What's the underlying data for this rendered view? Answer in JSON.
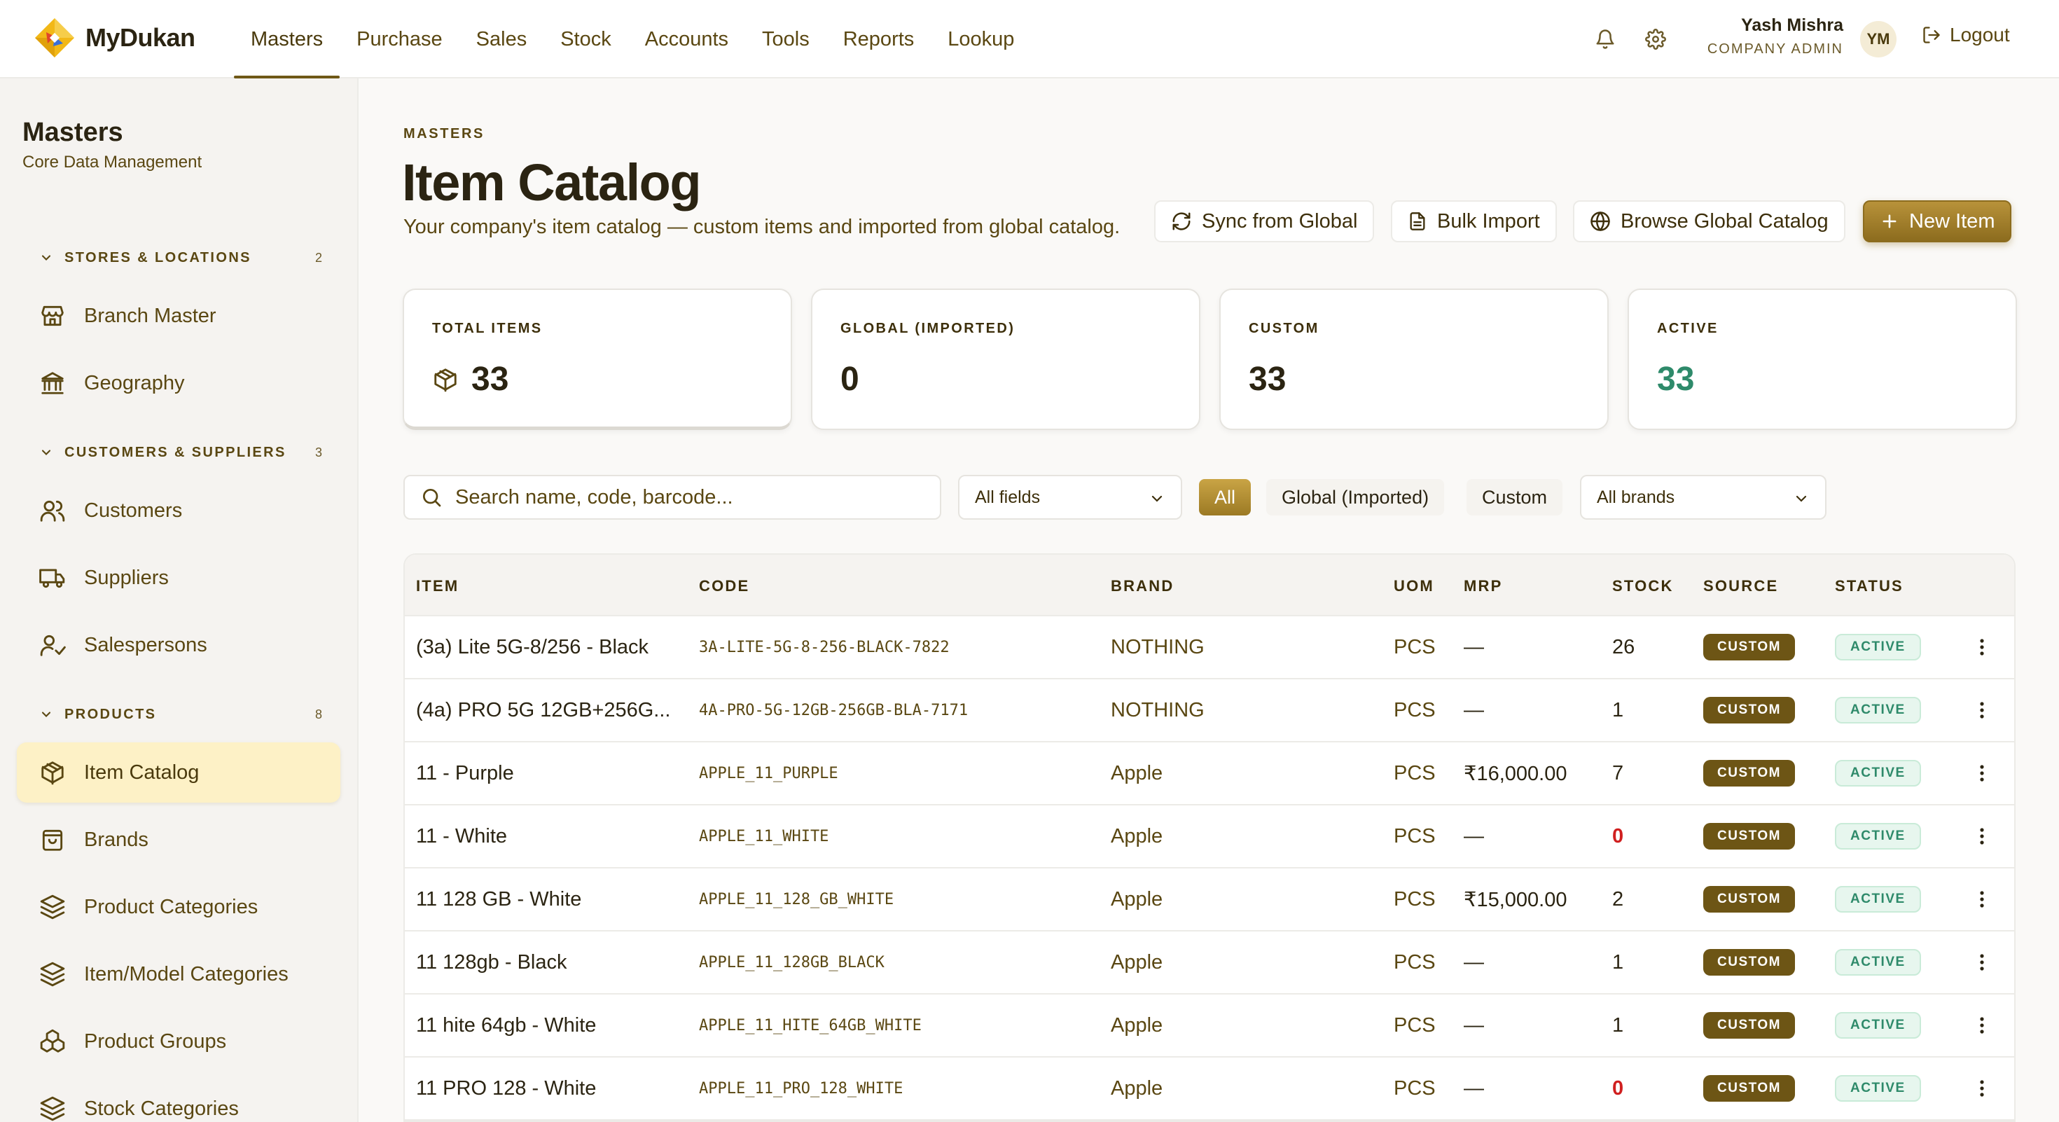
{
  "app": {
    "name": "MyDukan"
  },
  "nav": [
    "Masters",
    "Purchase",
    "Sales",
    "Stock",
    "Accounts",
    "Tools",
    "Reports",
    "Lookup"
  ],
  "user": {
    "name": "Yash Mishra",
    "role": "COMPANY ADMIN",
    "initials": "YM",
    "logout_label": "Logout"
  },
  "sidebar": {
    "title": "Masters",
    "subtitle": "Core Data Management",
    "sections": [
      {
        "label": "STORES & LOCATIONS",
        "count": "2"
      },
      {
        "label": "CUSTOMERS & SUPPLIERS",
        "count": "3"
      },
      {
        "label": "PRODUCTS",
        "count": "8"
      }
    ],
    "items": [
      {
        "label": "Branch Master",
        "icon": "store-icon"
      },
      {
        "label": "Geography",
        "icon": "bank-icon"
      },
      {
        "label": "Customers",
        "icon": "users-icon"
      },
      {
        "label": "Suppliers",
        "icon": "truck-icon"
      },
      {
        "label": "Salespersons",
        "icon": "user-check-icon"
      },
      {
        "label": "Item Catalog",
        "icon": "box-icon",
        "active": true
      },
      {
        "label": "Brands",
        "icon": "shopping-bag-icon"
      },
      {
        "label": "Product Categories",
        "icon": "layers-icon"
      },
      {
        "label": "Item/Model Categories",
        "icon": "layers-icon"
      },
      {
        "label": "Product Groups",
        "icon": "boxes-icon"
      },
      {
        "label": "Stock Categories",
        "icon": "layers-icon"
      }
    ]
  },
  "page": {
    "breadcrumb": "MASTERS",
    "title": "Item Catalog",
    "description": "Your company's item catalog — custom items and imported from global catalog."
  },
  "actions": {
    "sync": "Sync from Global",
    "bulk_import": "Bulk Import",
    "browse": "Browse Global Catalog",
    "new_item": "New Item"
  },
  "stats": [
    {
      "label": "TOTAL ITEMS",
      "value": "33"
    },
    {
      "label": "GLOBAL (IMPORTED)",
      "value": "0"
    },
    {
      "label": "CUSTOM",
      "value": "33"
    },
    {
      "label": "ACTIVE",
      "value": "33"
    }
  ],
  "filters": {
    "search_placeholder": "Search name, code, barcode...",
    "fields_select": "All fields",
    "chips": [
      "All",
      "Global (Imported)",
      "Custom"
    ],
    "brands_select": "All brands"
  },
  "table": {
    "columns": [
      "ITEM",
      "CODE",
      "BRAND",
      "UOM",
      "MRP",
      "STOCK",
      "SOURCE",
      "STATUS"
    ],
    "rows": [
      {
        "item": "(3a) Lite 5G-8/256 - Black",
        "code": "3A-LITE-5G-8-256-BLACK-7822",
        "brand": "NOTHING",
        "uom": "PCS",
        "mrp": "—",
        "stock": "26",
        "source": "CUSTOM",
        "status": "ACTIVE"
      },
      {
        "item": "(4a) PRO 5G 12GB+256G...",
        "code": "4A-PRO-5G-12GB-256GB-BLA-7171",
        "brand": "NOTHING",
        "uom": "PCS",
        "mrp": "—",
        "stock": "1",
        "source": "CUSTOM",
        "status": "ACTIVE"
      },
      {
        "item": "11 - Purple",
        "code": "APPLE_11_PURPLE",
        "brand": "Apple",
        "uom": "PCS",
        "mrp": "₹16,000.00",
        "stock": "7",
        "source": "CUSTOM",
        "status": "ACTIVE"
      },
      {
        "item": "11 - White",
        "code": "APPLE_11_WHITE",
        "brand": "Apple",
        "uom": "PCS",
        "mrp": "—",
        "stock": "0",
        "source": "CUSTOM",
        "status": "ACTIVE"
      },
      {
        "item": "11 128 GB - White",
        "code": "APPLE_11_128_GB_WHITE",
        "brand": "Apple",
        "uom": "PCS",
        "mrp": "₹15,000.00",
        "stock": "2",
        "source": "CUSTOM",
        "status": "ACTIVE"
      },
      {
        "item": "11 128gb - Black",
        "code": "APPLE_11_128GB_BLACK",
        "brand": "Apple",
        "uom": "PCS",
        "mrp": "—",
        "stock": "1",
        "source": "CUSTOM",
        "status": "ACTIVE"
      },
      {
        "item": "11 hite 64gb - White",
        "code": "APPLE_11_HITE_64GB_WHITE",
        "brand": "Apple",
        "uom": "PCS",
        "mrp": "—",
        "stock": "1",
        "source": "CUSTOM",
        "status": "ACTIVE"
      },
      {
        "item": "11 PRO 128 - White",
        "code": "APPLE_11_PRO_128_WHITE",
        "brand": "Apple",
        "uom": "PCS",
        "mrp": "—",
        "stock": "0",
        "source": "CUSTOM",
        "status": "ACTIVE"
      }
    ]
  },
  "colors": {
    "accent": "#6f5816",
    "primary_button": "#9c7a24",
    "active_green": "#2e8a6a",
    "zero_stock_red": "#d01f1f",
    "sidebar_active_bg": "#fdf1c6"
  }
}
